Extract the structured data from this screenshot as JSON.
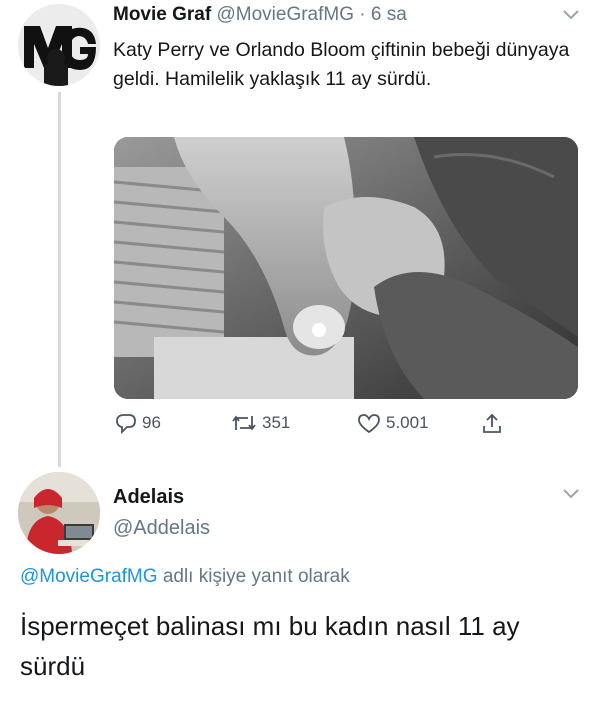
{
  "tweet": {
    "author_name": "Movie Graf",
    "author_handle": "@MovieGrafMG",
    "separator": "·",
    "time": "6 sa",
    "text": "Katy Perry ve Orlando Bloom çiftinin bebeği dünyaya geldi. Hamilelik yaklaşık 11 ay sürdü.",
    "media_description": "black-and-white-photo-baby-hand",
    "actions": {
      "replies": "96",
      "retweets": "351",
      "likes": "5.001"
    }
  },
  "reply": {
    "author_name": "Adelais",
    "author_handle": "@Addelais",
    "reply_to_handle": "@MovieGrafMG",
    "reply_to_suffix": "adlı kişiye yanıt olarak",
    "text": "İspermeçet balinası mı bu kadın nasıl 11 ay sürdü"
  },
  "icons": [
    "chevron-down-icon",
    "reply-icon",
    "retweet-icon",
    "like-icon",
    "share-icon"
  ],
  "colors": {
    "text": "#14171a",
    "muted": "#657786",
    "link": "#1b95e0",
    "thread_line": "#d6dade"
  }
}
